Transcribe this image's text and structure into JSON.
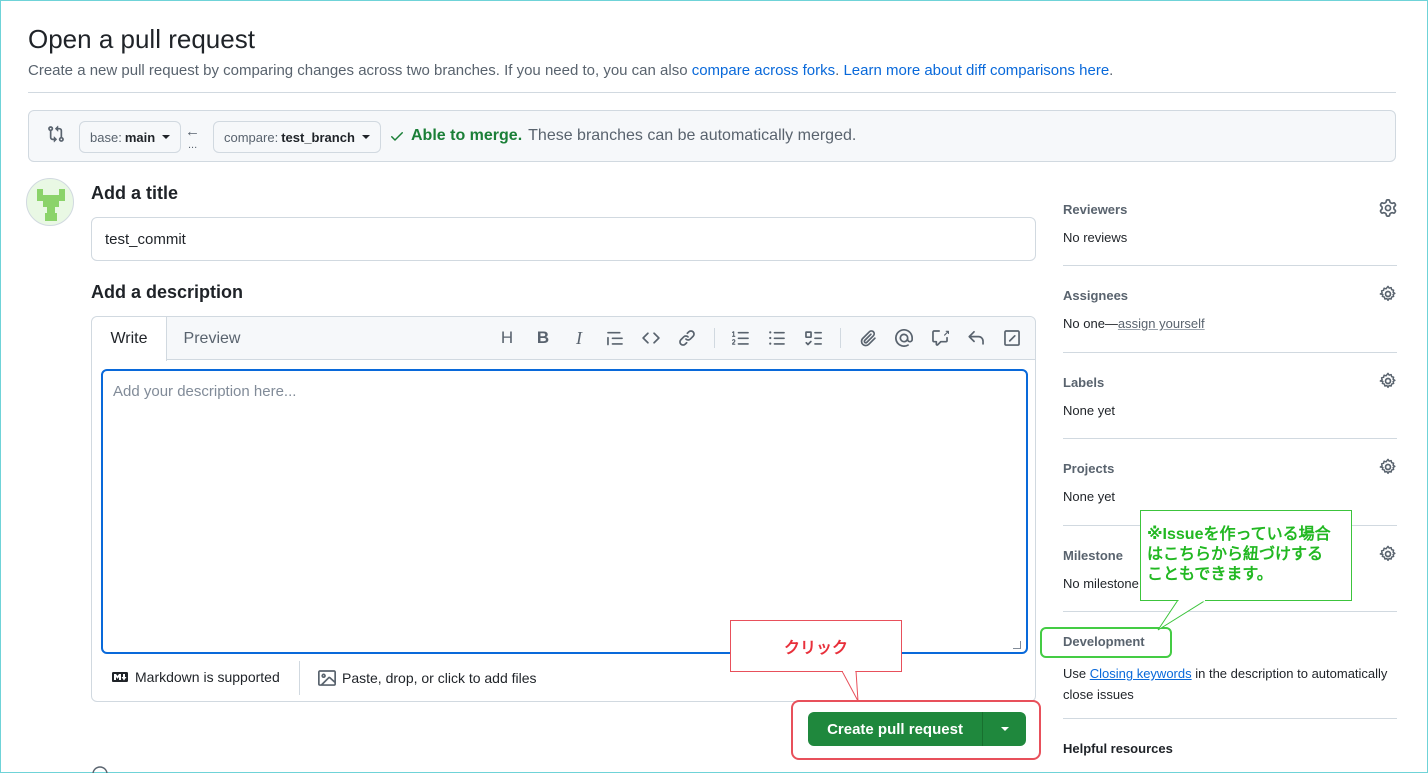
{
  "page": {
    "title": "Open a pull request",
    "subtitle_prefix": "Create a new pull request by comparing changes across two branches. If you need to, you can also ",
    "subtitle_link1": "compare across forks",
    "subtitle_mid": ". ",
    "subtitle_link2": "Learn more about diff comparisons here",
    "subtitle_end": "."
  },
  "compare": {
    "base_prefix": "base:",
    "base_branch": "main",
    "compare_prefix": "compare:",
    "compare_branch": "test_branch",
    "merge_ok": "Able to merge.",
    "merge_msg": "These branches can be automatically merged."
  },
  "form": {
    "title_label": "Add a title",
    "title_value": "test_commit",
    "description_label": "Add a description",
    "tab_write": "Write",
    "tab_preview": "Preview",
    "description_placeholder": "Add your description here...",
    "markdown_note": "Markdown is supported",
    "attach_note": "Paste, drop, or click to add files",
    "create_button": "Create pull request"
  },
  "toolbar": {
    "icons": [
      "heading-icon",
      "bold-icon",
      "italic-icon",
      "quote-icon",
      "code-icon",
      "link-icon",
      "numbered-list-icon",
      "unordered-list-icon",
      "task-list-icon",
      "attach-icon",
      "mention-icon",
      "cross-reference-icon",
      "reply-icon",
      "fullscreen-icon"
    ]
  },
  "sidebar": {
    "reviewers_title": "Reviewers",
    "reviewers_value": "No reviews",
    "assignees_title": "Assignees",
    "assignees_value": "No one—",
    "assignees_link": "assign yourself",
    "labels_title": "Labels",
    "labels_value": "None yet",
    "projects_title": "Projects",
    "projects_value": "None yet",
    "milestone_title": "Milestone",
    "milestone_value": "No milestone",
    "development_title": "Development",
    "development_prefix": "Use ",
    "development_link": "Closing keywords",
    "development_suffix": " in the description to automatically close issues",
    "helpful_title": "Helpful resources"
  },
  "annotations": {
    "click": "クリック",
    "issue_line1": "※Issueを作っている場合",
    "issue_line2": "はこちらから紐づけする",
    "issue_line3": "こともできます。"
  },
  "colors": {
    "accent": "#0969da",
    "create_green": "#1f883d",
    "merge_green": "#1a7f37",
    "annotation_red": "#e8505b",
    "annotation_green": "#44cc44"
  }
}
